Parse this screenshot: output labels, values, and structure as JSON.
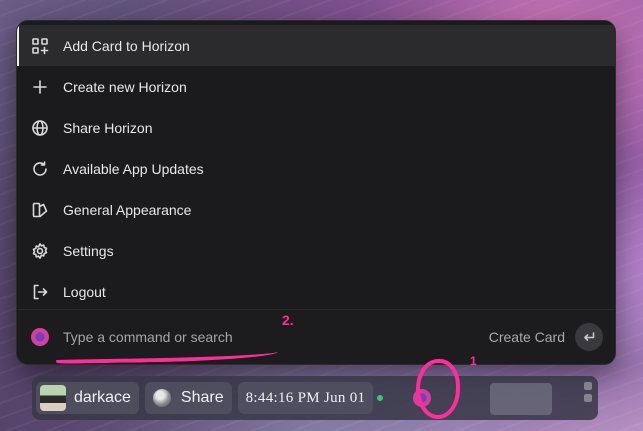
{
  "menu": {
    "items": [
      {
        "label": "Add Card to Horizon",
        "icon": "add-grid-icon",
        "active": true
      },
      {
        "label": "Create new Horizon",
        "icon": "plus-icon"
      },
      {
        "label": "Share Horizon",
        "icon": "globe-icon"
      },
      {
        "label": "Available App Updates",
        "icon": "refresh-icon"
      },
      {
        "label": "General Appearance",
        "icon": "appearance-icon"
      },
      {
        "label": "Settings",
        "icon": "gear-icon"
      },
      {
        "label": "Logout",
        "icon": "logout-icon"
      }
    ]
  },
  "command_bar": {
    "placeholder": "Type a command or search",
    "value": "",
    "create_card_label": "Create Card",
    "enter_icon": "return-icon"
  },
  "annotations": {
    "label_1": "1",
    "label_2": "2.",
    "color": "#ff2d9a"
  },
  "taskbar": {
    "user_name": "darkace",
    "share_label": "Share",
    "clock": "8:44:16 PM Jun 01",
    "status_color": "#2ecc71"
  }
}
